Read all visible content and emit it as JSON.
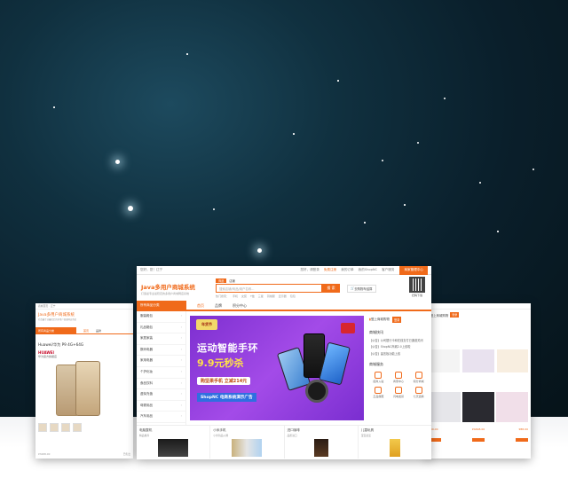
{
  "main_window": {
    "topbar": {
      "greeting": "您好，您！辽宁",
      "links": [
        "您好，请登录",
        "免费注册",
        "我的订单",
        "我的ShopNC",
        "客户服务"
      ],
      "seller_button": "商家管理中心"
    },
    "logo": {
      "title": "Java多用户商城系统",
      "subtitle": "打造最专业最稳定的多用户商城网店系统"
    },
    "search": {
      "tabs": [
        "商品",
        "店铺"
      ],
      "placeholder": "搜索店铺/商品/用户名称...",
      "button": "搜 索",
      "hot_words": [
        "热门搜索：",
        "手机",
        "女装",
        "T恤",
        "三星",
        "羽绒服",
        "显示器",
        "包包"
      ]
    },
    "cart_label": "去购物车结算",
    "qr_label": "扫码下载",
    "nav": {
      "category_label": "所有商品分类",
      "items": [
        "首页",
        "品牌",
        "积分中心"
      ]
    },
    "categories": [
      "服装鞋包",
      "礼品箱包",
      "家居家装",
      "数码电器",
      "家用电器",
      "个护化妆",
      "食品饮料",
      "虚拟充值",
      "母婴用品",
      "汽车用品",
      "玩具乐器"
    ],
    "banner": {
      "badge": "年货节",
      "title": "运动智能手环",
      "price": "9.9元秒杀",
      "pill": "购坚果手机 立减214元",
      "footer": "ShopNC 电商系统演示广告"
    },
    "right_panel": {
      "promo_text": "登上商城购物",
      "promo_button": "登录",
      "news_title": "商城快讯",
      "news": [
        "【公告】公司银行卡和在线支付已通道关闭",
        "【公告】ShopNC商城2.0上线啦",
        "【公告】留言板功能上线"
      ],
      "services_title": "商城服务",
      "services": [
        "招商入驻",
        "商家中心",
        "积分商城",
        "正品保障",
        "闪电发货",
        "七天退换"
      ]
    },
    "bottom_cells": [
      {
        "title": "电脑整机",
        "sub": "精品推荐"
      },
      {
        "title": "小米手机",
        "sub": "小米新品火爆"
      },
      {
        "title": "进口咖啡",
        "sub": "品质进口"
      },
      {
        "title": "儿童玩具",
        "sub": "宝宝最爱"
      }
    ]
  },
  "left_window": {
    "topbar": "商城首页 · 辽宁",
    "logo": {
      "title": "Java多用户商城系统",
      "subtitle": "打造最专业最稳定的多用户商城网店系统"
    },
    "nav": [
      "所有商品分类",
      "首页",
      "品牌"
    ],
    "product_title": "Huawei/华为 P9 4G+64G",
    "brand": "HUAWEI",
    "product_sub": "华为官方旗舰店",
    "footer": [
      "¥3488.00",
      "已售出"
    ]
  },
  "right_window": {
    "promo_text": "登上商城购物",
    "promo_button": "登录",
    "prices": [
      "¥99.00",
      "¥4498.00",
      "¥88.00"
    ]
  },
  "colors": {
    "accent": "#f06a1a",
    "banner": "#8b3ad8",
    "sky": "#0b2330"
  }
}
